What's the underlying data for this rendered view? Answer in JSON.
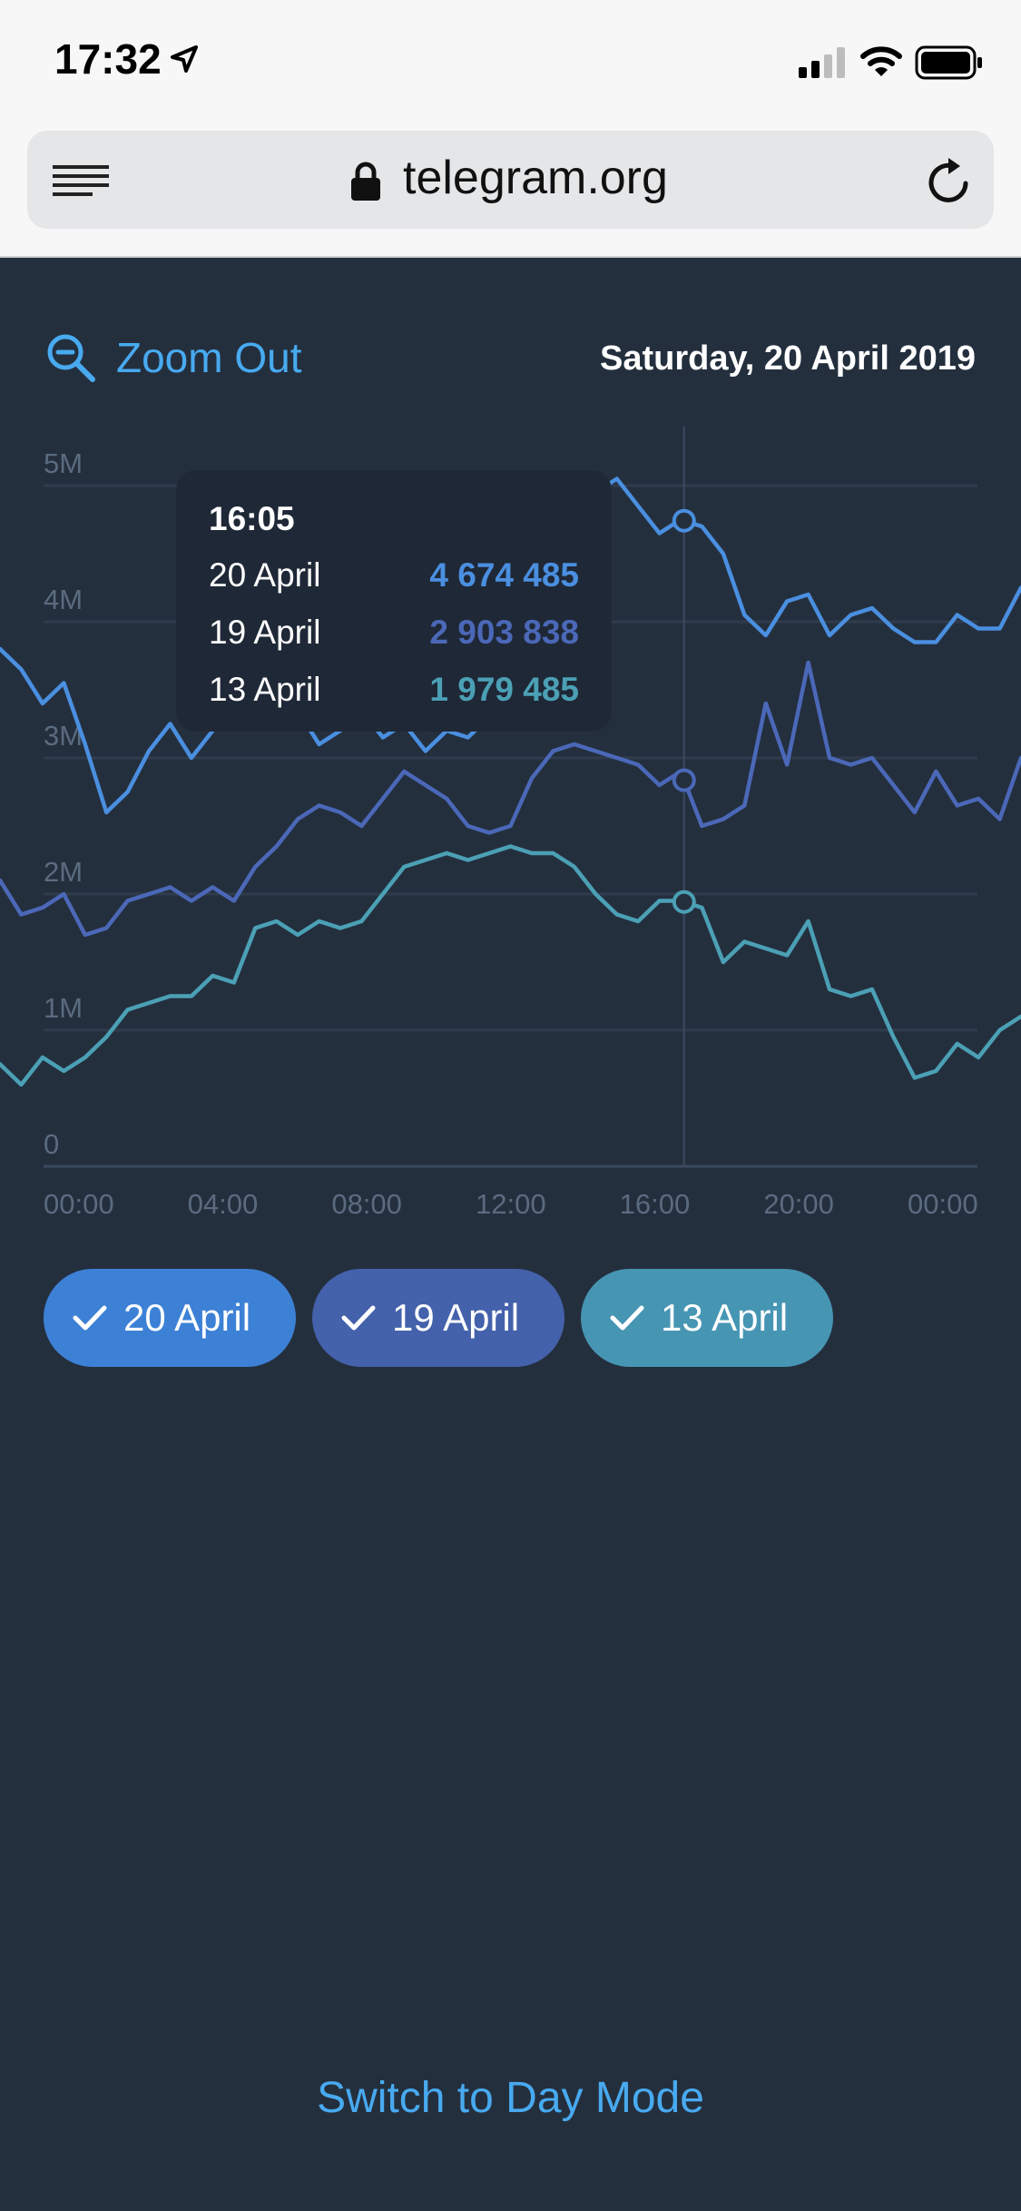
{
  "status_bar": {
    "time": "17:32"
  },
  "browser": {
    "url": "telegram.org"
  },
  "header": {
    "zoom_out_label": "Zoom Out",
    "date": "Saturday, 20 April 2019"
  },
  "tooltip": {
    "time": "16:05",
    "rows": [
      {
        "label": "20 April",
        "value": "4 674 485",
        "color": "#4a8fe0"
      },
      {
        "label": "19 April",
        "value": "2 903 838",
        "color": "#4b68b8"
      },
      {
        "label": "13 April",
        "value": "1 979 485",
        "color": "#4ba0b5"
      }
    ]
  },
  "legend": [
    {
      "label": "20 April",
      "color": "#3d81d6"
    },
    {
      "label": "19 April",
      "color": "#4461ab"
    },
    {
      "label": "13 April",
      "color": "#4695b3"
    }
  ],
  "footer": {
    "switch_mode": "Switch to Day Mode"
  },
  "chart_data": {
    "type": "line",
    "y_ticks": [
      "0",
      "1M",
      "2M",
      "3M",
      "4M",
      "5M"
    ],
    "x_ticks": [
      "00:00",
      "04:00",
      "08:00",
      "12:00",
      "16:00",
      "20:00",
      "00:00"
    ],
    "ylim": [
      0,
      5000000
    ],
    "xlim": [
      0,
      24
    ],
    "x": [
      0,
      0.5,
      1,
      1.5,
      2,
      2.5,
      3,
      3.5,
      4,
      4.5,
      5,
      5.5,
      6,
      6.5,
      7,
      7.5,
      8,
      8.5,
      9,
      9.5,
      10,
      10.5,
      11,
      11.5,
      12,
      12.5,
      13,
      13.5,
      14,
      14.5,
      15,
      15.5,
      16,
      16.5,
      17,
      17.5,
      18,
      18.5,
      19,
      19.5,
      20,
      20.5,
      21,
      21.5,
      22,
      22.5,
      23,
      23.5,
      24
    ],
    "selected_x": 16.08,
    "series": [
      {
        "name": "20 April",
        "color": "#4a8fe0",
        "values": [
          3800000,
          3650000,
          3400000,
          3550000,
          3100000,
          2600000,
          2750000,
          3050000,
          3250000,
          3000000,
          3200000,
          3400000,
          3500000,
          3300000,
          3350000,
          3100000,
          3200000,
          3350000,
          3150000,
          3250000,
          3050000,
          3200000,
          3150000,
          3300000,
          3400000,
          3600000,
          4300000,
          4600000,
          4950000,
          5050000,
          4850000,
          4650000,
          4750000,
          4700000,
          4500000,
          4050000,
          3900000,
          4150000,
          4200000,
          3900000,
          4050000,
          4100000,
          3950000,
          3850000,
          3850000,
          4050000,
          3950000,
          3950000,
          4250000
        ]
      },
      {
        "name": "19 April",
        "color": "#4b68b8",
        "values": [
          2100000,
          1850000,
          1900000,
          2000000,
          1700000,
          1750000,
          1950000,
          2000000,
          2050000,
          1950000,
          2050000,
          1950000,
          2200000,
          2350000,
          2550000,
          2650000,
          2600000,
          2500000,
          2700000,
          2900000,
          2800000,
          2700000,
          2500000,
          2450000,
          2500000,
          2850000,
          3050000,
          3100000,
          3050000,
          3000000,
          2950000,
          2800000,
          2900000,
          2500000,
          2550000,
          2650000,
          3400000,
          2950000,
          3700000,
          3000000,
          2950000,
          3000000,
          2800000,
          2600000,
          2900000,
          2650000,
          2700000,
          2550000,
          3000000
        ]
      },
      {
        "name": "13 April",
        "color": "#4ba0b5",
        "values": [
          750000,
          600000,
          800000,
          700000,
          800000,
          950000,
          1150000,
          1200000,
          1250000,
          1250000,
          1400000,
          1350000,
          1750000,
          1800000,
          1700000,
          1800000,
          1750000,
          1800000,
          2000000,
          2200000,
          2250000,
          2300000,
          2250000,
          2300000,
          2350000,
          2300000,
          2300000,
          2200000,
          2000000,
          1850000,
          1800000,
          1950000,
          1950000,
          1900000,
          1500000,
          1650000,
          1600000,
          1550000,
          1800000,
          1300000,
          1250000,
          1300000,
          950000,
          650000,
          700000,
          900000,
          800000,
          1000000,
          1100000
        ]
      }
    ]
  }
}
